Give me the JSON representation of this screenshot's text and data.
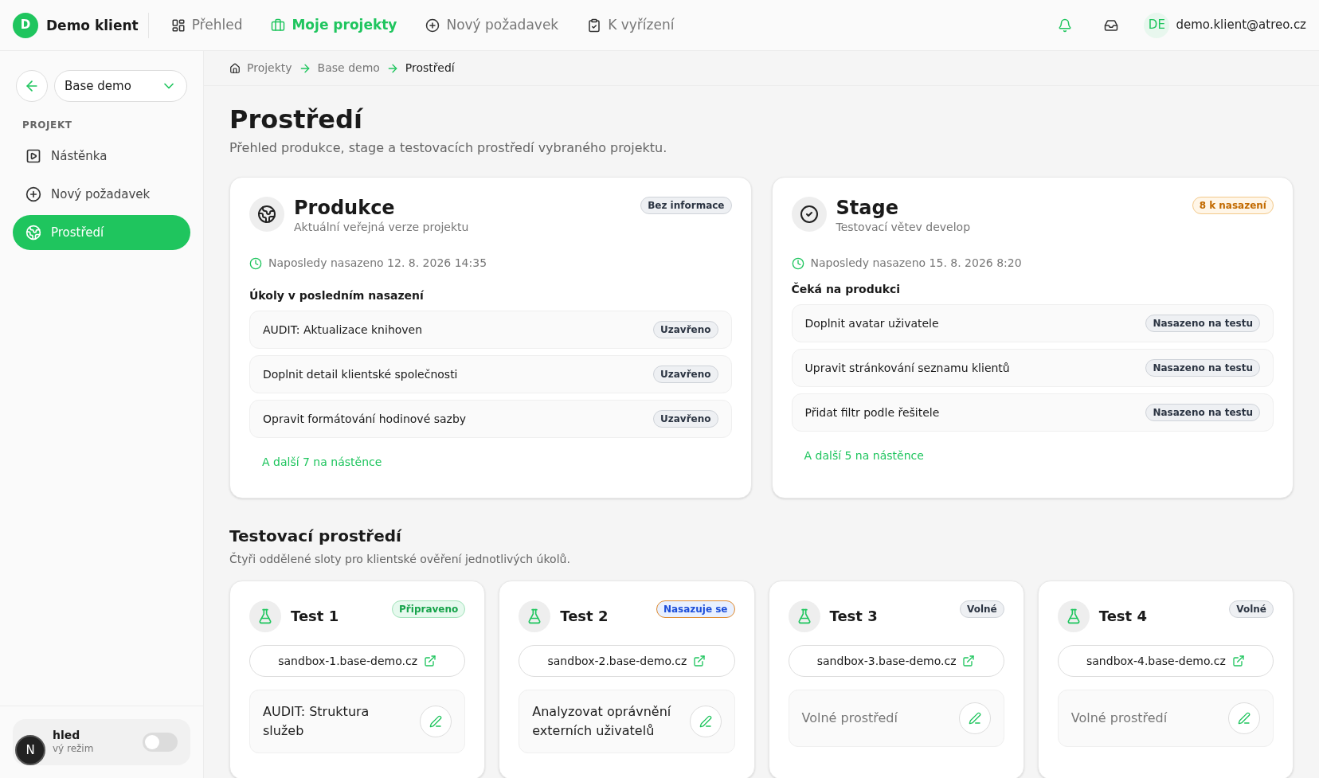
{
  "header": {
    "brand_initial": "D",
    "brand": "Demo klient",
    "nav": [
      {
        "label": "Přehled",
        "selected": false
      },
      {
        "label": "Moje projekty",
        "selected": true
      },
      {
        "label": "Nový požadavek",
        "selected": false
      },
      {
        "label": "K vyřízení",
        "selected": false
      }
    ],
    "user_initials": "DE",
    "user_email": "demo.klient@atreo.cz"
  },
  "sidebar": {
    "project_select": {
      "value": "Base demo"
    },
    "section_label": "PROJEKT",
    "items": [
      {
        "label": "Nástěnka",
        "selected": false
      },
      {
        "label": "Nový požadavek",
        "selected": false
      },
      {
        "label": "Prostředí",
        "selected": true
      }
    ],
    "appearance": {
      "title": "hled",
      "subtitle": "vý režim",
      "on": false
    },
    "dev_badge": "N"
  },
  "breadcrumb": [
    {
      "label": "Projekty"
    },
    {
      "label": "Base demo"
    },
    {
      "label": "Prostředí"
    }
  ],
  "page": {
    "title": "Prostředí",
    "subtitle": "Přehled produkce, stage a testovacích prostředí vybraného projektu."
  },
  "environments": [
    {
      "title": "Produkce",
      "subtitle": "Aktuální veřejná verze projektu",
      "badge": {
        "label": "Bez informace",
        "kind": "neutral"
      },
      "last_deploy": "Naposledy nasazeno 12. 8. 2026 14:35",
      "list_title": "Úkoly v posledním nasazení",
      "tasks": [
        {
          "title": "AUDIT: Aktualizace knihoven",
          "status": "Uzavřeno"
        },
        {
          "title": "Doplnit detail klientské společnosti",
          "status": "Uzavřeno"
        },
        {
          "title": "Opravit formátování hodinové sazby",
          "status": "Uzavřeno"
        }
      ],
      "more_link": "A další 7 na nástěnce"
    },
    {
      "title": "Stage",
      "subtitle": "Testovací větev develop",
      "badge": {
        "label": "8 k nasazení",
        "kind": "warning"
      },
      "last_deploy": "Naposledy nasazeno 15. 8. 2026 8:20",
      "list_title": "Čeká na produkci",
      "tasks": [
        {
          "title": "Doplnit avatar uživatele",
          "status": "Nasazeno na testu"
        },
        {
          "title": "Upravit stránkování seznamu klientů",
          "status": "Nasazeno na testu"
        },
        {
          "title": "Přidat filtr podle řešitele",
          "status": "Nasazeno na testu"
        }
      ],
      "more_link": "A další 5 na nástěnce"
    }
  ],
  "test_section": {
    "title": "Testovací prostředí",
    "subtitle": "Čtyři oddělené sloty pro klientské ověření jednotlivých úkolů.",
    "slots": [
      {
        "title": "Test 1",
        "badge": {
          "label": "Připraveno",
          "kind": "success"
        },
        "url": "sandbox-1.base-demo.cz",
        "task": "AUDIT: Struktura služeb",
        "empty": false
      },
      {
        "title": "Test 2",
        "badge": {
          "label": "Nasazuje se",
          "kind": "info"
        },
        "url": "sandbox-2.base-demo.cz",
        "task": "Analyzovat oprávnění externích uživatelů",
        "empty": false
      },
      {
        "title": "Test 3",
        "badge": {
          "label": "Volné",
          "kind": "neutral"
        },
        "url": "sandbox-3.base-demo.cz",
        "task": "Volné prostředí",
        "empty": true
      },
      {
        "title": "Test 4",
        "badge": {
          "label": "Volné",
          "kind": "neutral"
        },
        "url": "sandbox-4.base-demo.cz",
        "task": "Volné prostředí",
        "empty": true
      }
    ]
  }
}
